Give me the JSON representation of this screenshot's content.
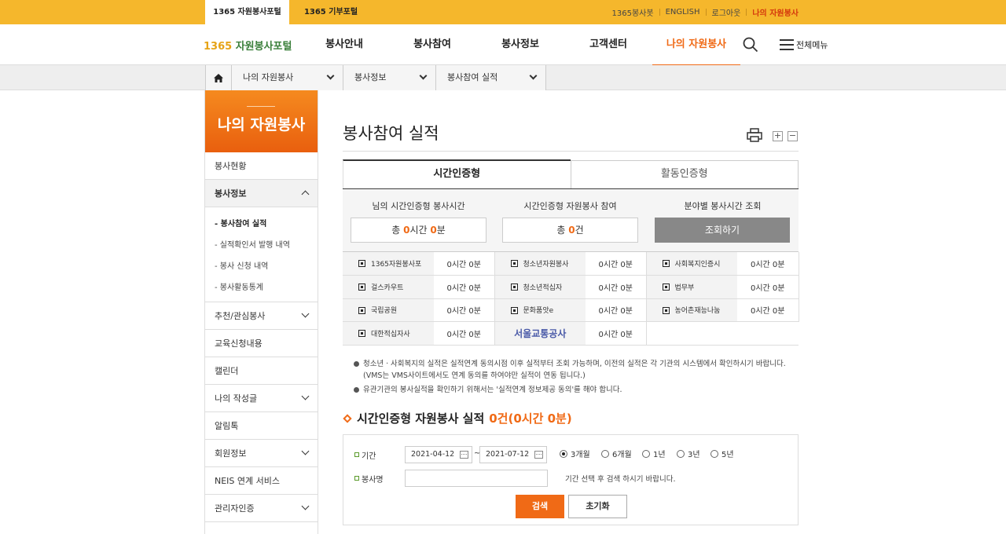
{
  "topbar": {
    "tabs": [
      "1365 자원봉사포털",
      "1365 기부포털"
    ],
    "links": [
      "1365봉사봇",
      "ENGLISH",
      "로그아웃",
      "나의 자원봉사"
    ]
  },
  "header": {
    "logo_num": "1365",
    "logo_text": " 자원봉사포털",
    "gnb": [
      "봉사안내",
      "봉사참여",
      "봉사정보",
      "고객센터",
      "나의 자원봉사"
    ],
    "full_menu": "전체메뉴"
  },
  "location": {
    "items": [
      "나의 자원봉사",
      "봉사정보",
      "봉사참여 실적"
    ]
  },
  "sidebar": {
    "title": "나의 자원봉사",
    "items_before": [
      "봉사현황"
    ],
    "open_item": "봉사정보",
    "sub_items": [
      "- 봉사참여 실적",
      "- 실적확인서 발행 내역",
      "- 봉사 신청 내역",
      "- 봉사활동통계"
    ],
    "items_after": [
      {
        "label": "추천/관심봉사",
        "chev": true
      },
      {
        "label": "교육신청내용",
        "chev": false
      },
      {
        "label": "캘린더",
        "chev": false
      },
      {
        "label": "나의 작성글",
        "chev": true
      },
      {
        "label": "알림톡",
        "chev": false
      },
      {
        "label": "회원정보",
        "chev": true
      },
      {
        "label": "NEIS 연계 서비스",
        "chev": false
      },
      {
        "label": "관리자인증",
        "chev": true
      }
    ]
  },
  "main": {
    "title": "봉사참여 실적",
    "zoom_in": "+",
    "zoom_out": "−",
    "tabs": [
      "시간인증형",
      "활동인증형"
    ],
    "summary": {
      "col1_label": "님의 시간인증형 봉사시간",
      "col1_prefix": "총 ",
      "col1_h": "0",
      "col1_mid": "시간 ",
      "col1_m": "0",
      "col1_suffix": "분",
      "col2_label": "시간인증형 자원봉사 참여",
      "col2_prefix": "총 ",
      "col2_n": "0",
      "col2_suffix": "건",
      "col3_label": "분야별 봉사시간 조회",
      "col3_button": "조회하기"
    },
    "orgs": [
      [
        {
          "name": "1365자원봉사포",
          "val": "0시간 0분"
        },
        {
          "name": "청소년자원봉사",
          "val": "0시간 0분"
        },
        {
          "name": "사회복지인증시",
          "val": "0시간 0분"
        }
      ],
      [
        {
          "name": "걸스카우트",
          "val": "0시간 0분"
        },
        {
          "name": "청소년적십자",
          "val": "0시간 0분"
        },
        {
          "name": "법무부",
          "val": "0시간 0분"
        }
      ],
      [
        {
          "name": "국립공원",
          "val": "0시간 0분"
        },
        {
          "name": "문화품앗e",
          "val": "0시간 0분"
        },
        {
          "name": "농어촌재능나눔",
          "val": "0시간 0분"
        }
      ],
      [
        {
          "name": "대한적십자사",
          "val": "0시간 0분"
        },
        {
          "name": "서울교통공사",
          "val": "0시간 0분"
        }
      ]
    ],
    "notes": [
      "청소년ㆍ사회복지의 실적은 실적연계 동의시점 이후 실적부터 조회 가능하며, 이전의 실적은 각 기관의 시스템에서 확인하시기 바랍니다.",
      "(VMS는 VMS사이트에서도 연계 동의를 하여야만 실적이 연동 됩니다.)",
      "유관기관의 봉사실적을 확인하기 위해서는 '실적연계 정보제공 동의'를 해야 합니다."
    ],
    "section_title": "시간인증형 자원봉사 실적",
    "section_count": "0건(0시간 0분)",
    "search": {
      "period_label": "기간",
      "date_from": "2021-04-12",
      "tilde": "~",
      "date_to": "2021-07-12",
      "radios": [
        "3개월",
        "6개월",
        "1년",
        "3년",
        "5년"
      ],
      "name_label": "봉사명",
      "name_value": "",
      "hint": "기간 선택 후 검색 하시기 바랍니다.",
      "search_button": "검색",
      "reset_button": "초기화"
    }
  },
  "colors": {
    "accent": "#f06a16",
    "topbar": "#f5b72c"
  }
}
